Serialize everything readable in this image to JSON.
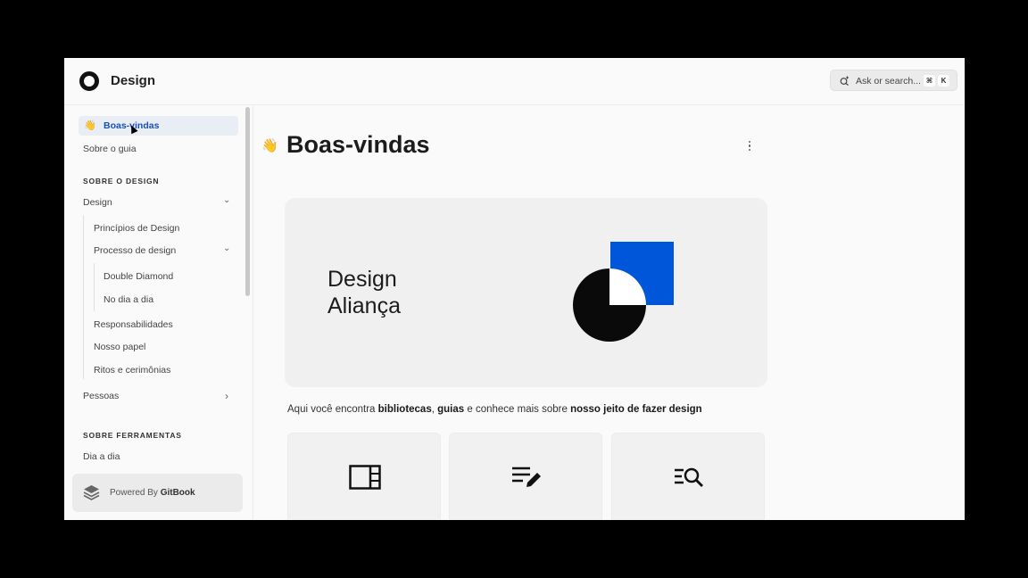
{
  "header": {
    "site_title": "Design",
    "search": {
      "placeholder": "Ask or search...",
      "kbd_cmd": "⌘",
      "kbd_k": "K"
    }
  },
  "sidebar": {
    "active": {
      "emoji": "👋",
      "label": "Boas-vindas"
    },
    "about_guide": "Sobre o guia",
    "section_design": "SOBRE O DESIGN",
    "design": "Design",
    "principles": "Princípios de Design",
    "process": "Processo de design",
    "double_diamond": "Double Diamond",
    "day_to_day": "No dia a dia",
    "responsibilities": "Responsabilidades",
    "our_role": "Nosso papel",
    "rites": "Ritos e cerimônias",
    "people": "Pessoas",
    "section_tools": "SOBRE FERRAMENTAS",
    "day_by_day": "Dia a dia",
    "powered_prefix": "Powered By ",
    "powered_brand": "GitBook"
  },
  "main": {
    "emoji": "👋",
    "title": "Boas-vindas",
    "hero_line1": "Design",
    "hero_line2": "Aliança",
    "intro": {
      "part1": "Aqui você encontra ",
      "bold1": "bibliotecas",
      "part2": ", ",
      "bold2": "guias",
      "part3": " e conhece mais sobre ",
      "bold3": "nosso jeito de fazer design"
    }
  },
  "colors": {
    "accent_blue": "#0056d8",
    "active_bg": "#e9eef5",
    "active_text": "#1a4fb6"
  }
}
